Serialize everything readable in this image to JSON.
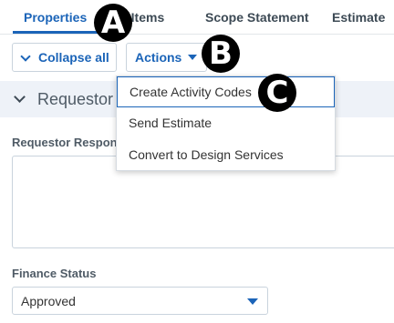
{
  "tabs": [
    {
      "label": "Properties"
    },
    {
      "label": "Line Items"
    },
    {
      "label": "Scope Statement"
    },
    {
      "label": "Estimate"
    }
  ],
  "toolbar": {
    "collapse_label": "Collapse all",
    "actions_label": "Actions"
  },
  "section": {
    "title": "Requestor Details"
  },
  "fields": {
    "requestor_response_label": "Requestor Response",
    "requestor_response_value": "",
    "finance_status_label": "Finance Status",
    "finance_status_value": "Approved"
  },
  "actions_menu": {
    "items": [
      {
        "label": "Create Activity Codes"
      },
      {
        "label": "Send Estimate"
      },
      {
        "label": "Convert to Design Services"
      }
    ]
  },
  "callouts": [
    "A",
    "B",
    "C"
  ],
  "colors": {
    "accent": "#1b64b8",
    "section_bg": "#eef2f8",
    "callout_bg": "#000000"
  },
  "icons": {
    "collapse": "chevron-down-icon",
    "actions": "caret-down-icon",
    "section": "chevron-down-icon",
    "select": "caret-down-icon"
  }
}
